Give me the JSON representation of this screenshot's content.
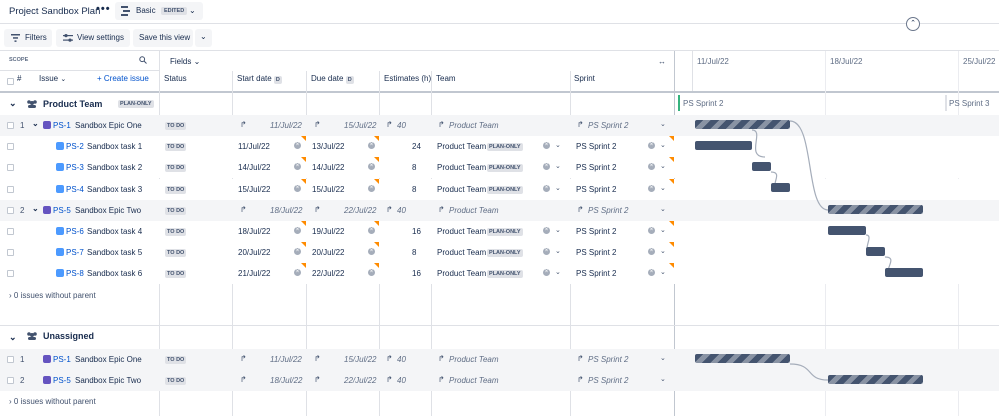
{
  "app": {
    "title": "Project Sandbox Plan",
    "more": "•••",
    "view_mode": "Basic",
    "edited_badge": "EDITED"
  },
  "toolbar": {
    "filters": "Filters",
    "view_settings": "View settings",
    "save_view": "Save this view"
  },
  "scope": {
    "label": "SCOPE",
    "fields": "Fields",
    "hash": "#",
    "issue": "Issue",
    "create_issue": "+ Create issue"
  },
  "columns": {
    "status": "Status",
    "start": "Start date",
    "due": "Due date",
    "estimates": "Estimates (h)",
    "team": "Team",
    "sprint": "Sprint",
    "date_badge": "D"
  },
  "timeline": {
    "dates": [
      "11/Jul/22",
      "18/Jul/22",
      "25/Jul/22"
    ],
    "sprint_markers": [
      "PS Sprint 2",
      "PS Sprint 3"
    ]
  },
  "groups": [
    {
      "name": "Product Team",
      "badge": "PLAN-ONLY",
      "without_parent": "0 issues without parent",
      "rows": [
        {
          "num": "1",
          "key": "PS-1",
          "summary": "Sandbox Epic One",
          "type": "epic",
          "status": "TO DO",
          "start": "11/Jul/22",
          "due": "15/Jul/22",
          "est": "40",
          "team": "Product Team",
          "team_badge": "",
          "sprint": "PS Sprint 2",
          "rolled": true
        },
        {
          "num": "",
          "key": "PS-2",
          "summary": "Sandbox task 1",
          "type": "task",
          "status": "TO DO",
          "start": "11/Jul/22",
          "due": "13/Jul/22",
          "est": "24",
          "team": "Product Team",
          "team_badge": "PLAN-ONLY",
          "sprint": "PS Sprint 2",
          "rolled": false
        },
        {
          "num": "",
          "key": "PS-3",
          "summary": "Sandbox task 2",
          "type": "task",
          "status": "TO DO",
          "start": "14/Jul/22",
          "due": "14/Jul/22",
          "est": "8",
          "team": "Product Team",
          "team_badge": "PLAN-ONLY",
          "sprint": "PS Sprint 2",
          "rolled": false
        },
        {
          "num": "",
          "key": "PS-4",
          "summary": "Sandbox task 3",
          "type": "task",
          "status": "TO DO",
          "start": "15/Jul/22",
          "due": "15/Jul/22",
          "est": "8",
          "team": "Product Team",
          "team_badge": "PLAN-ONLY",
          "sprint": "PS Sprint 2",
          "rolled": false
        },
        {
          "num": "2",
          "key": "PS-5",
          "summary": "Sandbox Epic Two",
          "type": "epic",
          "status": "TO DO",
          "start": "18/Jul/22",
          "due": "22/Jul/22",
          "est": "40",
          "team": "Product Team",
          "team_badge": "",
          "sprint": "PS Sprint 2",
          "rolled": true
        },
        {
          "num": "",
          "key": "PS-6",
          "summary": "Sandbox task 4",
          "type": "task",
          "status": "TO DO",
          "start": "18/Jul/22",
          "due": "19/Jul/22",
          "est": "16",
          "team": "Product Team",
          "team_badge": "PLAN-ONLY",
          "sprint": "PS Sprint 2",
          "rolled": false
        },
        {
          "num": "",
          "key": "PS-7",
          "summary": "Sandbox task 5",
          "type": "task",
          "status": "TO DO",
          "start": "20/Jul/22",
          "due": "20/Jul/22",
          "est": "8",
          "team": "Product Team",
          "team_badge": "PLAN-ONLY",
          "sprint": "PS Sprint 2",
          "rolled": false
        },
        {
          "num": "",
          "key": "PS-8",
          "summary": "Sandbox task 6",
          "type": "task",
          "status": "TO DO",
          "start": "21/Jul/22",
          "due": "22/Jul/22",
          "est": "16",
          "team": "Product Team",
          "team_badge": "PLAN-ONLY",
          "sprint": "PS Sprint 2",
          "rolled": false
        }
      ]
    },
    {
      "name": "Unassigned",
      "badge": "",
      "without_parent": "0 issues without parent",
      "rows": [
        {
          "num": "1",
          "key": "PS-1",
          "summary": "Sandbox Epic One",
          "type": "epic",
          "status": "TO DO",
          "start": "11/Jul/22",
          "due": "15/Jul/22",
          "est": "40",
          "team": "Product Team",
          "team_badge": "",
          "sprint": "PS Sprint 2",
          "rolled": true
        },
        {
          "num": "2",
          "key": "PS-5",
          "summary": "Sandbox Epic Two",
          "type": "epic",
          "status": "TO DO",
          "start": "18/Jul/22",
          "due": "22/Jul/22",
          "est": "40",
          "team": "Product Team",
          "team_badge": "",
          "sprint": "PS Sprint 2",
          "rolled": true
        }
      ]
    }
  ]
}
